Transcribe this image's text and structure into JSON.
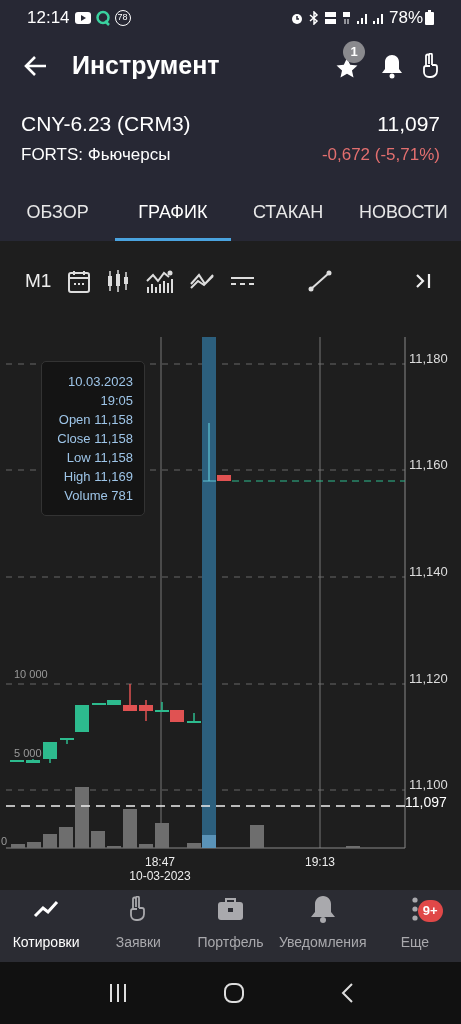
{
  "status_bar": {
    "time": "12:14",
    "notification_count": "78",
    "battery": "78%"
  },
  "header": {
    "title": "Инструмент",
    "favorites_badge": "1"
  },
  "instrument": {
    "name": "CNY-6.23 (CRM3)",
    "market": "FORTS: Фьючерсы",
    "price": "11,097",
    "change": "-0,672 (-5,71%)"
  },
  "tabs": [
    {
      "label": "ОБЗОР",
      "selected": false
    },
    {
      "label": "ГРАФИК",
      "selected": true
    },
    {
      "label": "СТАКАН",
      "selected": false
    },
    {
      "label": "НОВОСТИ",
      "selected": false
    }
  ],
  "toolbar": {
    "timeframe": "M1"
  },
  "chart": {
    "price_labels": [
      "11,180",
      "11,160",
      "11,140",
      "11,120",
      "11,100"
    ],
    "current_price": "11,097",
    "volume_labels": [
      "10 000",
      "5 000",
      "0"
    ],
    "time_labels": [
      {
        "time": "18:47",
        "date": "10-03-2023"
      },
      {
        "time": "19:13"
      }
    ],
    "tooltip": [
      "10.03.2023",
      "19:05",
      "Open 11,158",
      "Close 11,158",
      "Low 11,158",
      "High 11,169",
      "Volume 781"
    ]
  },
  "bottom_nav": [
    {
      "label": "Котировки",
      "selected": true,
      "kind": "quotes"
    },
    {
      "label": "Заявки",
      "selected": false,
      "kind": "orders"
    },
    {
      "label": "Портфель",
      "selected": false,
      "kind": "portfolio"
    },
    {
      "label": "Уведомления",
      "selected": false,
      "kind": "alerts"
    },
    {
      "label": "Еще",
      "selected": false,
      "kind": "more",
      "badge": "9+"
    }
  ]
}
